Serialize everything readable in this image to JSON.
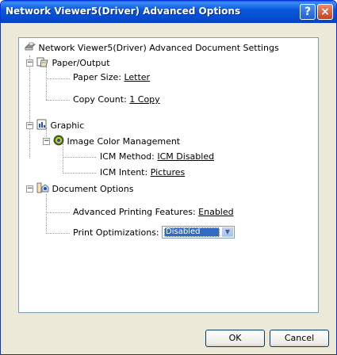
{
  "window": {
    "title": "Network Viewer5(Driver) Advanced Options",
    "help_glyph": "?",
    "close_glyph": "×"
  },
  "tree": {
    "root_label": "Network Viewer5(Driver) Advanced Document Settings",
    "paper_output": {
      "label": "Paper/Output",
      "paper_size_key": "Paper Size:",
      "paper_size_value": "Letter",
      "copy_count_key": "Copy Count:",
      "copy_count_value": "1 Copy"
    },
    "graphic": {
      "label": "Graphic",
      "icm": {
        "label": "Image Color Management",
        "method_key": "ICM Method:",
        "method_value": "ICM Disabled",
        "intent_key": "ICM Intent:",
        "intent_value": "Pictures"
      }
    },
    "document_options": {
      "label": "Document Options",
      "apf_key": "Advanced Printing Features:",
      "apf_value": "Enabled",
      "print_opt_key": "Print Optimizations:",
      "print_opt_value": "Disabled"
    }
  },
  "buttons": {
    "ok": "OK",
    "cancel": "Cancel"
  },
  "colors": {
    "titlebar": "#0a58dc",
    "dialog_bg": "#ece9d8",
    "selection": "#316ac5"
  },
  "icons": {
    "root": "printer-icon",
    "paper": "paper-icon",
    "graphic": "graphic-icon",
    "icm": "color-management-icon",
    "document": "document-options-icon"
  }
}
